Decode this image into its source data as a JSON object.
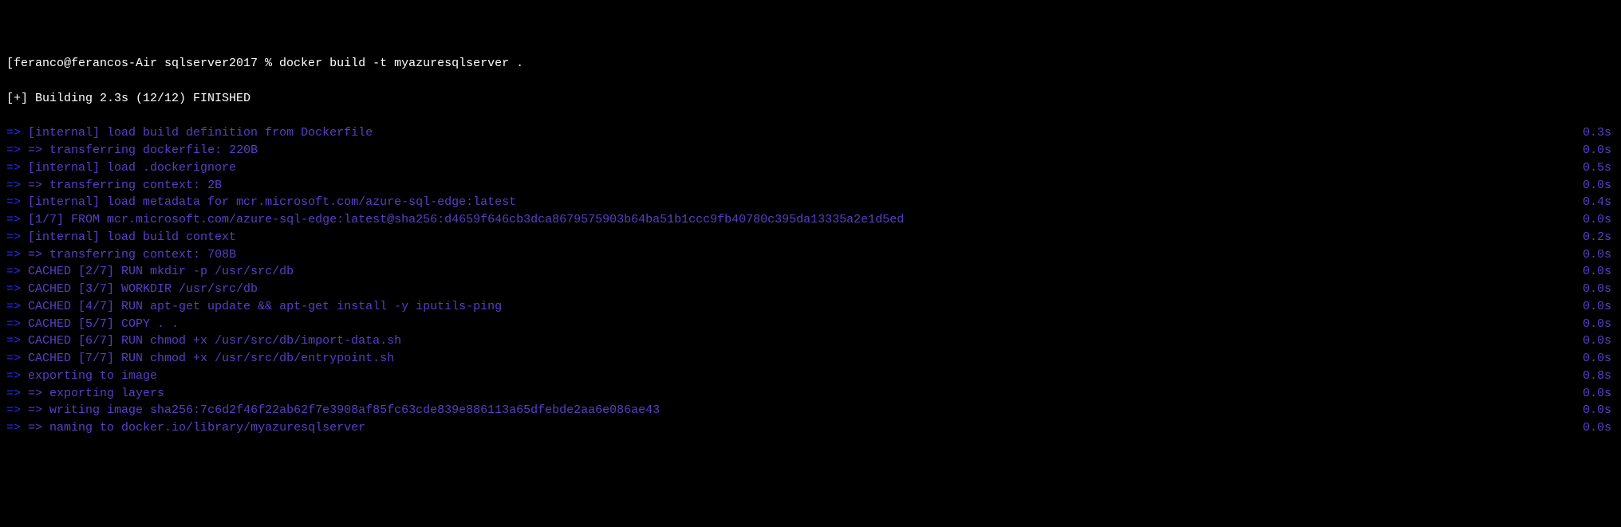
{
  "prompt": "[feranco@ferancos-Air sqlserver2017 % docker build -t myazuresqlserver .",
  "build_status": "[+] Building 2.3s (12/12) FINISHED",
  "arrow": "=>",
  "subarrow": "=> =>",
  "lines": [
    {
      "type": "main",
      "text": "[internal] load build definition from Dockerfile",
      "time": "0.3s"
    },
    {
      "type": "sub",
      "text": "transferring dockerfile: 220B",
      "time": "0.0s"
    },
    {
      "type": "main",
      "text": "[internal] load .dockerignore",
      "time": "0.5s"
    },
    {
      "type": "sub",
      "text": "transferring context: 2B",
      "time": "0.0s"
    },
    {
      "type": "main",
      "text": "[internal] load metadata for mcr.microsoft.com/azure-sql-edge:latest",
      "time": "0.4s"
    },
    {
      "type": "main",
      "text": "[1/7] FROM mcr.microsoft.com/azure-sql-edge:latest@sha256:d4659f646cb3dca8679575903b64ba51b1ccc9fb40780c395da13335a2e1d5ed",
      "time": "0.0s"
    },
    {
      "type": "main",
      "text": "[internal] load build context",
      "time": "0.2s"
    },
    {
      "type": "sub",
      "text": "transferring context: 708B",
      "time": "0.0s"
    },
    {
      "type": "main",
      "text": "CACHED [2/7] RUN mkdir -p /usr/src/db",
      "time": "0.0s"
    },
    {
      "type": "main",
      "text": "CACHED [3/7] WORKDIR /usr/src/db",
      "time": "0.0s"
    },
    {
      "type": "main",
      "text": "CACHED [4/7] RUN apt-get update && apt-get install -y iputils-ping",
      "time": "0.0s"
    },
    {
      "type": "main",
      "text": "CACHED [5/7] COPY . .",
      "time": "0.0s"
    },
    {
      "type": "main",
      "text": "CACHED [6/7] RUN chmod +x /usr/src/db/import-data.sh",
      "time": "0.0s"
    },
    {
      "type": "main",
      "text": "CACHED [7/7] RUN chmod +x /usr/src/db/entrypoint.sh",
      "time": "0.0s"
    },
    {
      "type": "main",
      "text": "exporting to image",
      "time": "0.8s"
    },
    {
      "type": "sub",
      "text": "exporting layers",
      "time": "0.0s"
    },
    {
      "type": "sub",
      "text": "writing image sha256:7c6d2f46f22ab62f7e3908af85fc63cde839e886113a65dfebde2aa6e086ae43",
      "time": "0.0s"
    },
    {
      "type": "sub",
      "text": "naming to docker.io/library/myazuresqlserver",
      "time": "0.0s"
    }
  ]
}
